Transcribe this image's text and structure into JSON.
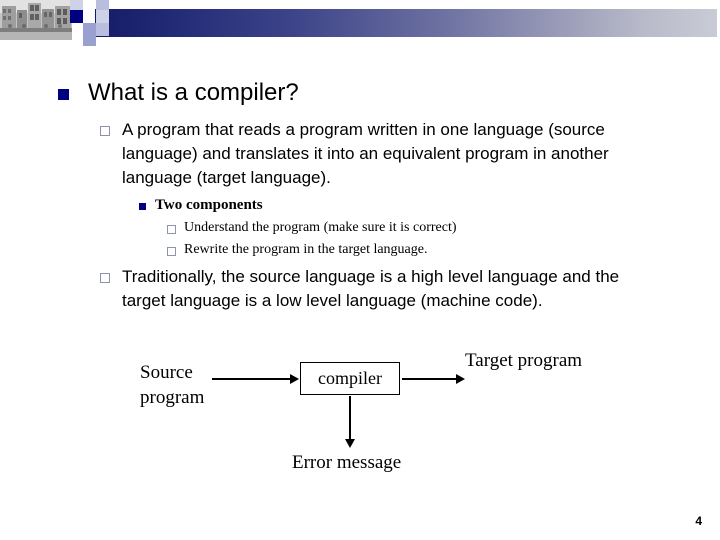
{
  "slide": {
    "title": "What is a compiler?",
    "page_number": "4",
    "title_bullet_icon": "filled-square-bullet-icon",
    "header": {
      "photo_icon": "campus-building-photo",
      "gradient_start_color": "#161b66",
      "gradient_end_color": "#c9cbd6",
      "accent_navy": "#000080",
      "accent_light": "#b9bede"
    },
    "bullets": [
      {
        "level": 1,
        "bullet_icon": "hollow-square-bullet-icon",
        "text": "A program that reads a program written in one language (source language) and translates it into an equivalent program in another language (target language)."
      },
      {
        "level": 2,
        "bullet_icon": "filled-square-bullet-icon",
        "text": "Two components"
      },
      {
        "level": 3,
        "bullet_icon": "hollow-square-bullet-icon",
        "text": "Understand the program (make sure it is correct)"
      },
      {
        "level": 3,
        "bullet_icon": "hollow-square-bullet-icon",
        "text": "Rewrite the program in the target language."
      },
      {
        "level": 1,
        "bullet_icon": "hollow-square-bullet-icon",
        "text": "Traditionally, the source language is a high level language and  the target language is a low level language (machine code)."
      }
    ],
    "diagram": {
      "source_label": "Source program",
      "compiler_label": "compiler",
      "target_label": "Target program",
      "error_label": "Error message",
      "arrows": [
        {
          "name": "source-to-compiler",
          "direction": "right"
        },
        {
          "name": "compiler-to-target",
          "direction": "right"
        },
        {
          "name": "compiler-to-error",
          "direction": "down"
        }
      ]
    }
  }
}
